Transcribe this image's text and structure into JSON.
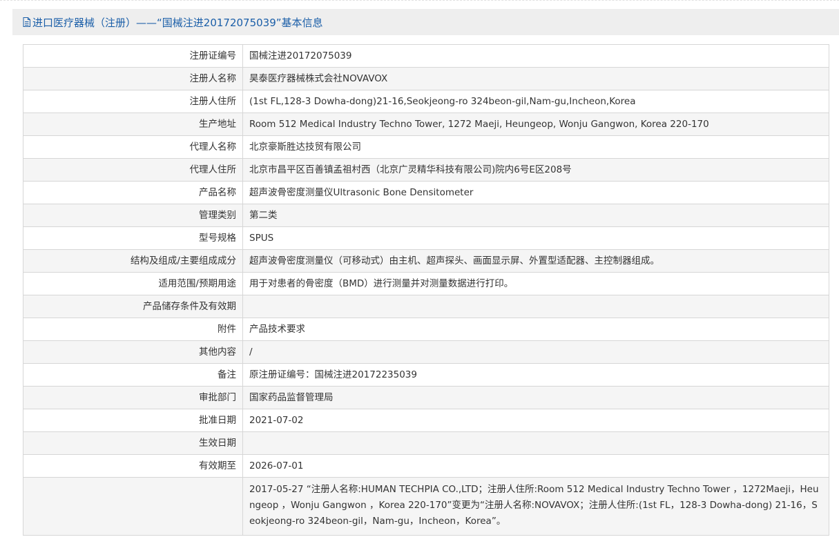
{
  "header": {
    "title": "进口医疗器械（注册）——“国械注进20172075039”基本信息"
  },
  "rows": [
    {
      "label": "注册证编号",
      "value": "国械注进20172075039"
    },
    {
      "label": "注册人名称",
      "value": "昊泰医疗器械株式会社NOVAVOX"
    },
    {
      "label": "注册人住所",
      "value": "(1st FL,128-3 Dowha-dong)21-16,Seokjeong-ro 324beon-gil,Nam-gu,Incheon,Korea"
    },
    {
      "label": "生产地址",
      "value": "Room 512 Medical Industry Techno Tower, 1272 Maeji, Heungeop, Wonju Gangwon, Korea 220-170"
    },
    {
      "label": "代理人名称",
      "value": "北京豪斯胜达技贸有限公司"
    },
    {
      "label": "代理人住所",
      "value": "北京市昌平区百善镇孟祖村西（北京广灵精华科技有限公司)院内6号E区208号"
    },
    {
      "label": "产品名称",
      "value": "超声波骨密度测量仪Ultrasonic Bone Densitometer"
    },
    {
      "label": "管理类别",
      "value": "第二类"
    },
    {
      "label": "型号规格",
      "value": "SPUS"
    },
    {
      "label": "结构及组成/主要组成成分",
      "value": "超声波骨密度测量仪（可移动式）由主机、超声探头、画面显示屏、外置型适配器、主控制器组成。"
    },
    {
      "label": "适用范围/预期用途",
      "value": "用于对患者的骨密度（BMD）进行测量并对测量数据进行打印。"
    },
    {
      "label": "产品储存条件及有效期",
      "value": ""
    },
    {
      "label": "附件",
      "value": "产品技术要求"
    },
    {
      "label": "其他内容",
      "value": "/"
    },
    {
      "label": "备注",
      "value": "原注册证编号：国械注进20172235039"
    },
    {
      "label": "审批部门",
      "value": "国家药品监督管理局"
    },
    {
      "label": "批准日期",
      "value": "2021-07-02"
    },
    {
      "label": "生效日期",
      "value": ""
    },
    {
      "label": "有效期至",
      "value": "2026-07-01"
    }
  ],
  "change": {
    "label": "",
    "value": "2017-05-27 “注册人名称:HUMAN TECHPIA CO.,LTD；注册人住所:Room 512 Medical Industry Techno Tower ，1272Maeji，Heungeop ，Wonju Gangwon ，Korea 220-170”变更为“注册人名称:NOVAVOX；注册人住所:(1st FL，128-3 Dowha-dong) 21-16，Seokjeong-ro 324beon-gil，Nam-gu，Incheon，Korea”。"
  }
}
